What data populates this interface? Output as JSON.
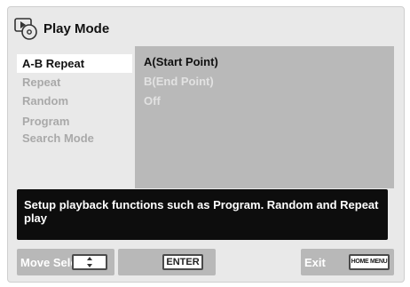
{
  "header": {
    "title": "Play Mode",
    "icon": "disc-play-icon"
  },
  "menu": {
    "items": [
      {
        "label": "A-B Repeat",
        "selected": true
      },
      {
        "label": "Repeat",
        "selected": false
      },
      {
        "label": "Random",
        "selected": false
      },
      {
        "label": "Program",
        "selected": false
      },
      {
        "label": "Search Mode",
        "selected": false
      }
    ]
  },
  "options": {
    "items": [
      {
        "label": "A(Start Point)",
        "selected": true
      },
      {
        "label": "B(End Point)",
        "selected": false
      },
      {
        "label": "Off",
        "selected": false
      }
    ]
  },
  "help": {
    "text": "Setup playback functions such as Program. Random and Repeat play"
  },
  "footer": {
    "move_label": "Move Select",
    "enter_key": "ENTER",
    "exit_label": "Exit",
    "home_menu_key": "HOME MENU"
  },
  "colors": {
    "background": "#e9e9e9",
    "selected_bg": "#ffffff",
    "options_panel": "#b9b9b9",
    "help_bar": "#0d0d0d",
    "footer_bar": "#b8b8b8",
    "dim_text": "#a9a9a9"
  }
}
